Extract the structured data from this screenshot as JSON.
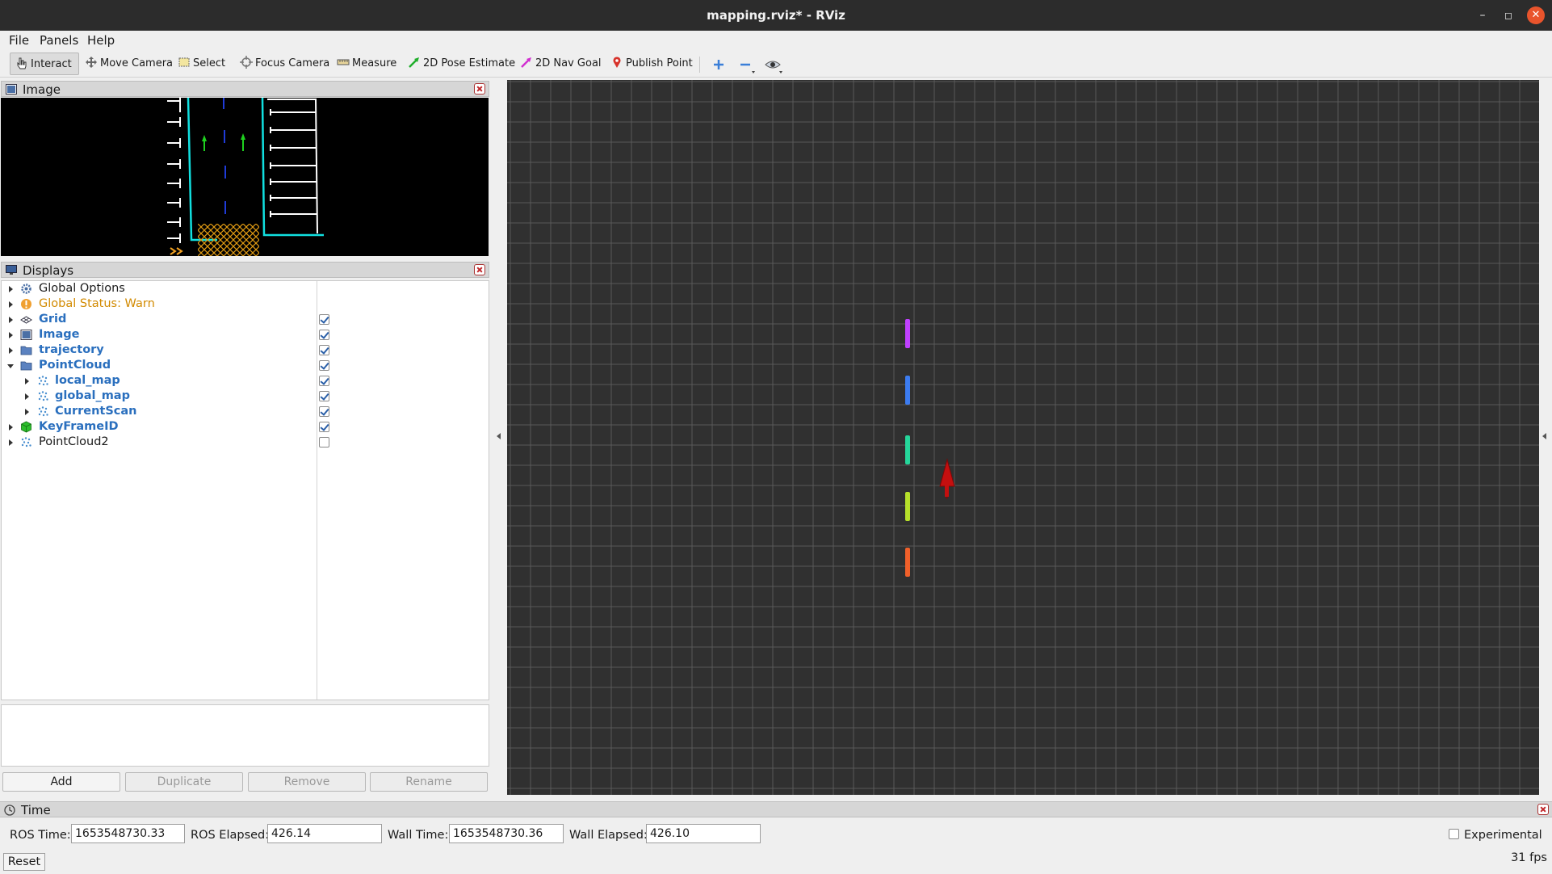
{
  "window": {
    "title": "mapping.rviz* - RViz"
  },
  "menu": {
    "file": "File",
    "panels": "Panels",
    "help": "Help"
  },
  "toolbar": {
    "interact": "Interact",
    "move_camera": "Move Camera",
    "select": "Select",
    "focus_camera": "Focus Camera",
    "measure": "Measure",
    "pose_estimate": "2D Pose Estimate",
    "nav_goal": "2D Nav Goal",
    "publish_point": "Publish Point"
  },
  "image_panel": {
    "title": "Image"
  },
  "displays_panel": {
    "title": "Displays",
    "items": [
      {
        "label": "Global Options"
      },
      {
        "label": "Global Status: Warn"
      },
      {
        "label": "Grid",
        "checked": true
      },
      {
        "label": "Image",
        "checked": true
      },
      {
        "label": "trajectory",
        "checked": true
      },
      {
        "label": "PointCloud",
        "checked": true
      },
      {
        "label": "local_map",
        "checked": true
      },
      {
        "label": "global_map",
        "checked": true
      },
      {
        "label": "CurrentScan",
        "checked": true
      },
      {
        "label": "KeyFrameID",
        "checked": true
      },
      {
        "label": "PointCloud2",
        "checked": false
      }
    ],
    "buttons": {
      "add": "Add",
      "duplicate": "Duplicate",
      "remove": "Remove",
      "rename": "Rename"
    }
  },
  "time_panel": {
    "title": "Time",
    "ros_time_label": "ROS Time:",
    "ros_time": "1653548730.33",
    "ros_elapsed_label": "ROS Elapsed:",
    "ros_elapsed": "426.14",
    "wall_time_label": "Wall Time:",
    "wall_time": "1653548730.36",
    "wall_elapsed_label": "Wall Elapsed:",
    "wall_elapsed": "426.10",
    "experimental_label": "Experimental",
    "reset": "Reset",
    "fps": "31 fps"
  },
  "colors": {
    "viewport_bg": "#303030",
    "grid_line": "#595959",
    "arrow": "#c40f0f",
    "keyframes": [
      "#c040ff",
      "#3c7cf0",
      "#25d69a",
      "#b6e02a",
      "#f0602a"
    ]
  }
}
